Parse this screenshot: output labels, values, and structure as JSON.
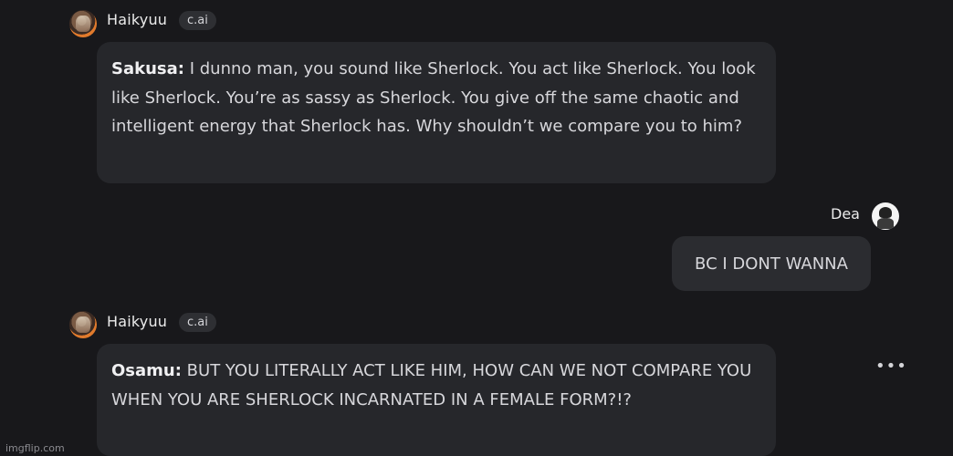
{
  "messages": [
    {
      "author": "Haikyuu",
      "badge": "c.ai",
      "speaker": "Sakusa:",
      "text": "I dunno man, you sound like Sherlock. You act like Sherlock. You look like Sherlock. You’re as sassy as Sherlock. You give off the same chaotic and intelligent energy that Sherlock has. Why shouldn’t we compare you to him?"
    },
    {
      "author": "Dea",
      "text": "BC I DONT WANNA"
    },
    {
      "author": "Haikyuu",
      "badge": "c.ai",
      "speaker": "Osamu:",
      "text": "BUT YOU LITERALLY ACT LIKE HIM, HOW CAN WE NOT COMPARE YOU WHEN YOU ARE SHERLOCK INCARNATED IN A FEMALE FORM?!?"
    }
  ],
  "more_menu_icon": "more-horizontal-icon",
  "watermark": "imgflip.com"
}
